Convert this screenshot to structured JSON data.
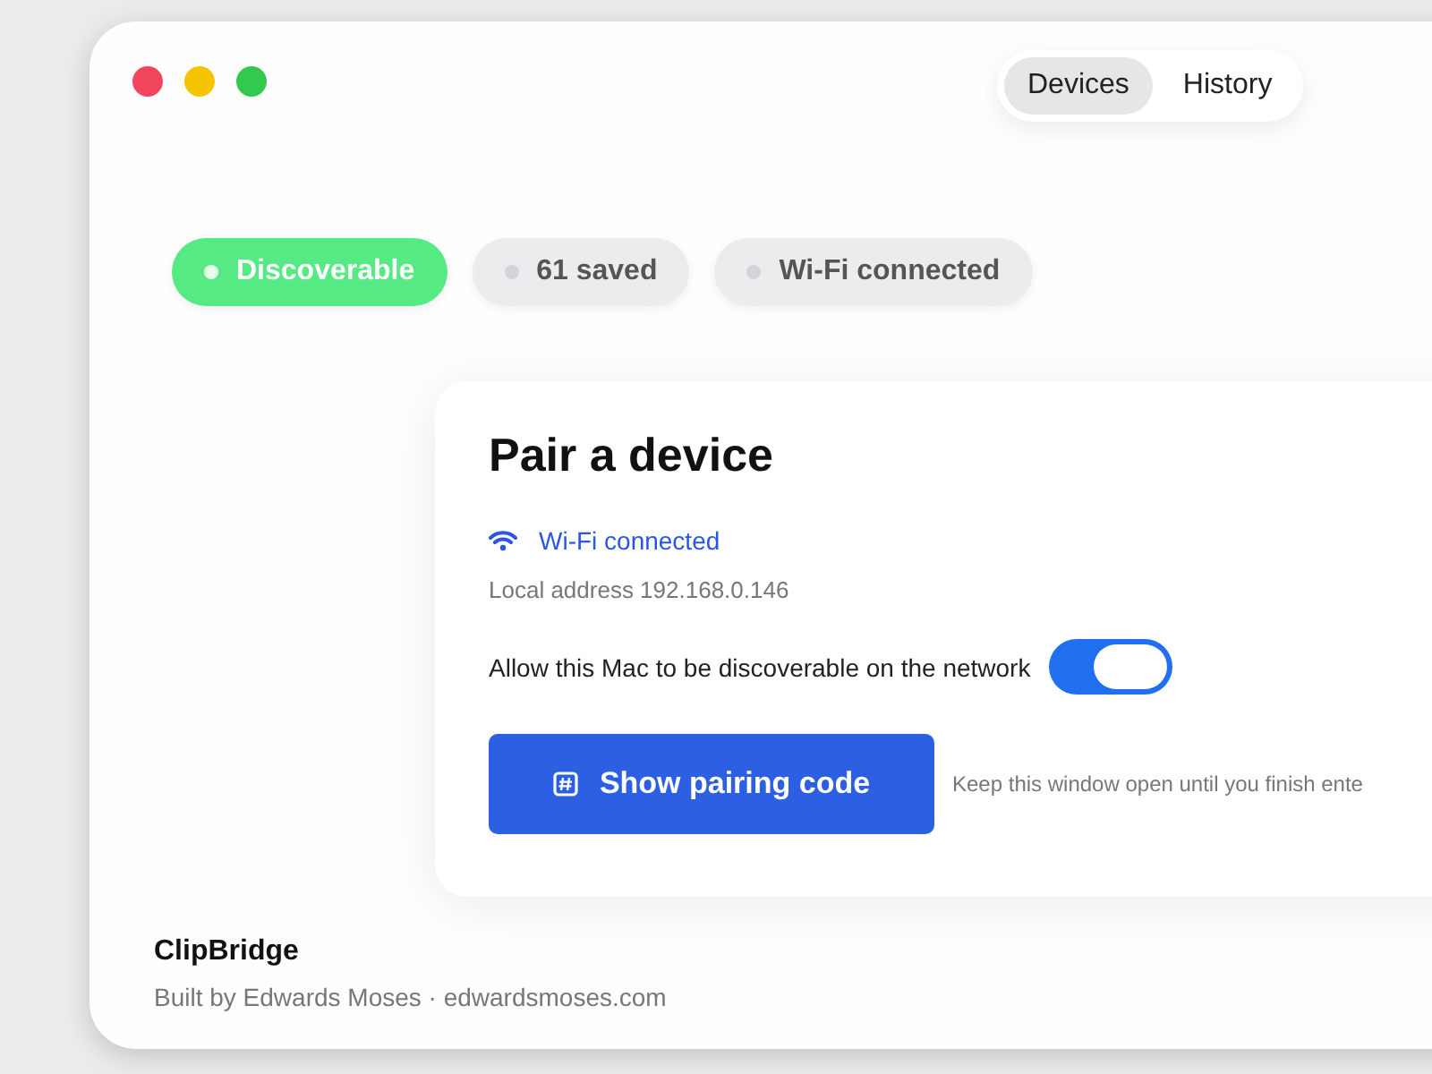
{
  "tabs": [
    {
      "label": "Devices",
      "selected": true
    },
    {
      "label": "History",
      "selected": false
    }
  ],
  "chips": [
    {
      "label": "Discoverable",
      "selected": true
    },
    {
      "label": "61 saved",
      "selected": false
    },
    {
      "label": "Wi-Fi connected",
      "selected": false
    }
  ],
  "pair_card": {
    "title": "Pair a device",
    "network": "Wi-Fi connected",
    "address": "Local address 192.168.0.146",
    "toggle": {
      "label": "Allow this Mac to be discoverable on the network",
      "on": true
    },
    "button": "Show pairing code",
    "hint": "Keep this window open until you finish ente"
  },
  "footer": {
    "app_name": "ClipBridge",
    "credit": "Built by Edwards Moses · edwardsmoses.com"
  }
}
